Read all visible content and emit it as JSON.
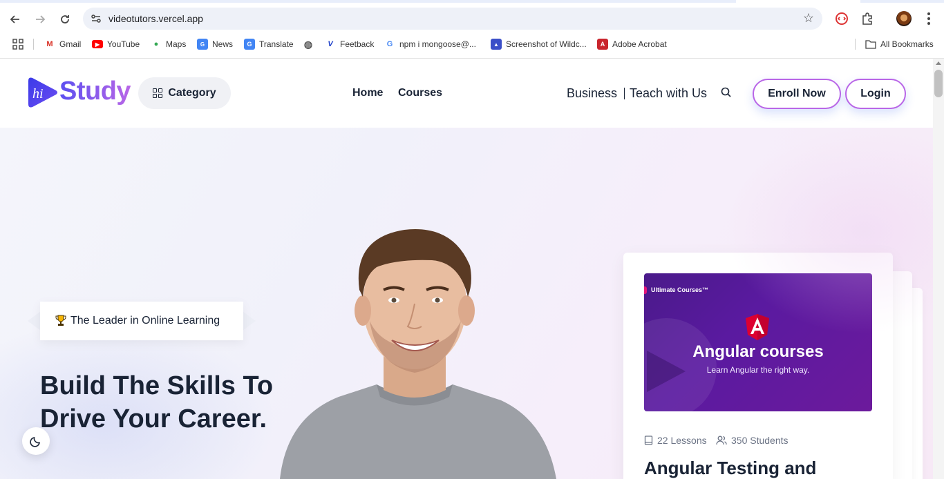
{
  "browser": {
    "url": "videotutors.vercel.app",
    "bookmarks": [
      {
        "label": "Gmail",
        "icon": "gmail-icon"
      },
      {
        "label": "YouTube",
        "icon": "youtube-icon"
      },
      {
        "label": "Maps",
        "icon": "maps-icon"
      },
      {
        "label": "News",
        "icon": "news-icon"
      },
      {
        "label": "Translate",
        "icon": "translate-icon"
      },
      {
        "label": "",
        "icon": "globe-icon"
      },
      {
        "label": "Feetback",
        "icon": "v-logo-icon"
      },
      {
        "label": "npm i mongoose@...",
        "icon": "google-icon"
      },
      {
        "label": "Screenshot of Wildc...",
        "icon": "screenshot-icon"
      },
      {
        "label": "Adobe Acrobat",
        "icon": "acrobat-icon"
      }
    ],
    "all_bookmarks": "All Bookmarks"
  },
  "header": {
    "logo_text": "Study",
    "logo_mark": "hi",
    "category_label": "Category",
    "nav": [
      "Home",
      "Courses"
    ],
    "business": "Business",
    "teach": "Teach with Us",
    "enroll": "Enroll Now",
    "login": "Login"
  },
  "hero": {
    "badge": "The Leader in Online Learning",
    "title": "Build The Skills To Drive Your Career."
  },
  "course_card": {
    "brand": "Ultimate Courses™",
    "thumb_title": "Angular courses",
    "thumb_sub": "Learn Angular the right way.",
    "lessons": "22 Lessons",
    "students": "350 Students",
    "title": "Angular Testing and"
  },
  "colors": {
    "brand_gradient_start": "#5b4ff0",
    "brand_gradient_end": "#b966e7",
    "heading": "#192335"
  }
}
